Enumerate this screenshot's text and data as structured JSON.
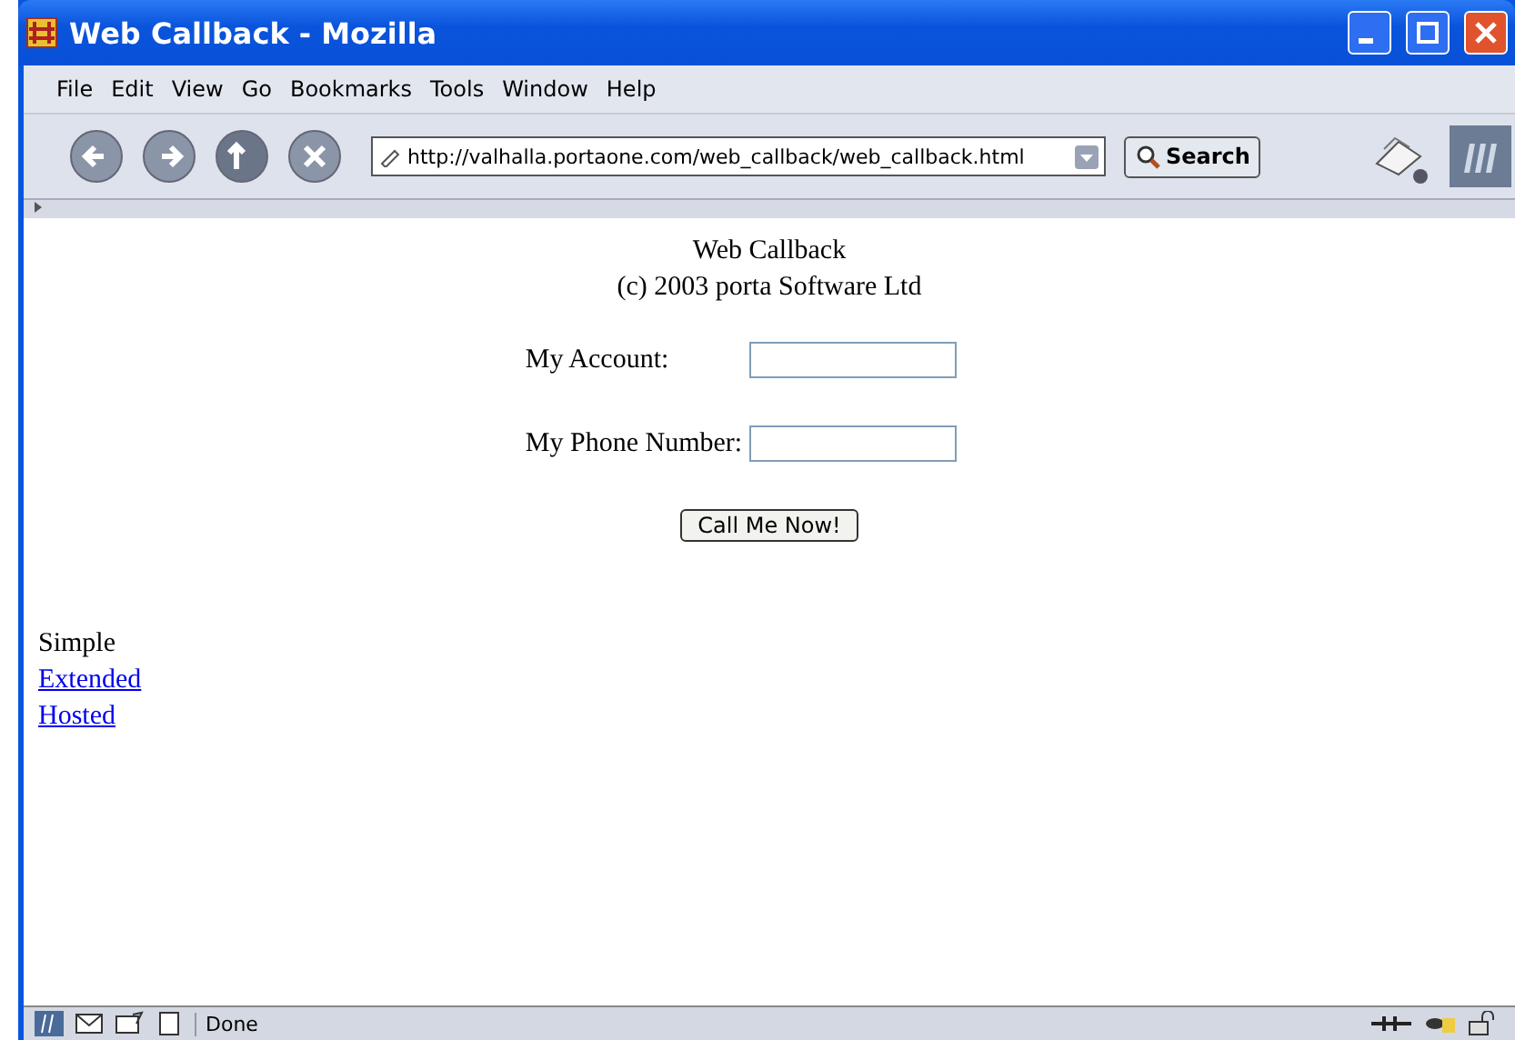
{
  "window": {
    "title": "Web Callback - Mozilla"
  },
  "menu": [
    "File",
    "Edit",
    "View",
    "Go",
    "Bookmarks",
    "Tools",
    "Window",
    "Help"
  ],
  "toolbar": {
    "address": "http://valhalla.portaone.com/web_callback/web_callback.html",
    "search_button": "Search"
  },
  "page": {
    "heading": "Web Callback",
    "copyright": "(c) 2003 porta Software Ltd",
    "fields": [
      {
        "label": "My Account:"
      },
      {
        "label": "My Phone Number:"
      }
    ],
    "submit": "Call Me Now!",
    "modes": [
      {
        "label": "Simple",
        "selected": true
      },
      {
        "label": "Extended",
        "selected": false
      },
      {
        "label": "Hosted",
        "selected": false
      }
    ]
  },
  "status_bar": {
    "text": "Done"
  }
}
